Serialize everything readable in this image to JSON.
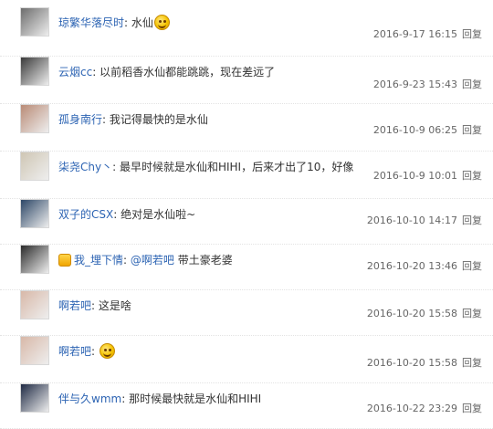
{
  "comments": [
    {
      "user": "琼繁华落尽时",
      "sep": ":",
      "text": "水仙",
      "emoji": "smile-emoji",
      "date": "2016-9-17 16:15",
      "reply": "回复",
      "avatar_color": "#6d6d6d"
    },
    {
      "user": "云烟cc",
      "sep": ":",
      "text": "以前稻香水仙都能跳跳，现在差远了",
      "date": "2016-9-23 15:43",
      "reply": "回复",
      "avatar_color": "#3a3a3a"
    },
    {
      "user": "孤身南行",
      "sep": ":",
      "text": "我记得最快的是水仙",
      "date": "2016-10-9 06:25",
      "reply": "回复",
      "avatar_color": "#b98b76"
    },
    {
      "user": "柒尧Chy丶",
      "sep": ":",
      "text": "最早时候就是水仙和HIHI，后来才出了10，好像",
      "date": "2016-10-9 10:01",
      "reply": "回复",
      "avatar_color": "#cfc6b4"
    },
    {
      "user": "双子的CSX",
      "sep": ":",
      "text": "绝对是水仙啦~",
      "date": "2016-10-10 14:17",
      "reply": "回复",
      "avatar_color": "#2c4666"
    },
    {
      "user": "我_埋下情",
      "sep": ":",
      "mention": "@啊若吧",
      "text": "带土豪老婆",
      "badge": "vip-badge-icon",
      "date": "2016-10-20 13:46",
      "reply": "回复",
      "avatar_color": "#2a2a2a"
    },
    {
      "user": "啊若吧",
      "sep": ":",
      "text": "这是啥",
      "date": "2016-10-20 15:58",
      "reply": "回复",
      "avatar_color": "#d8b8a8"
    },
    {
      "user": "啊若吧",
      "sep": ":",
      "text": "",
      "emoji": "smile-emoji",
      "date": "2016-10-20 15:58",
      "reply": "回复",
      "avatar_color": "#d8b8a8"
    },
    {
      "user": "伴与久wmm",
      "sep": ":",
      "text": "那时候最快就是水仙和HIHI",
      "date": "2016-10-22 23:29",
      "reply": "回复",
      "avatar_color": "#1f2a44"
    }
  ]
}
